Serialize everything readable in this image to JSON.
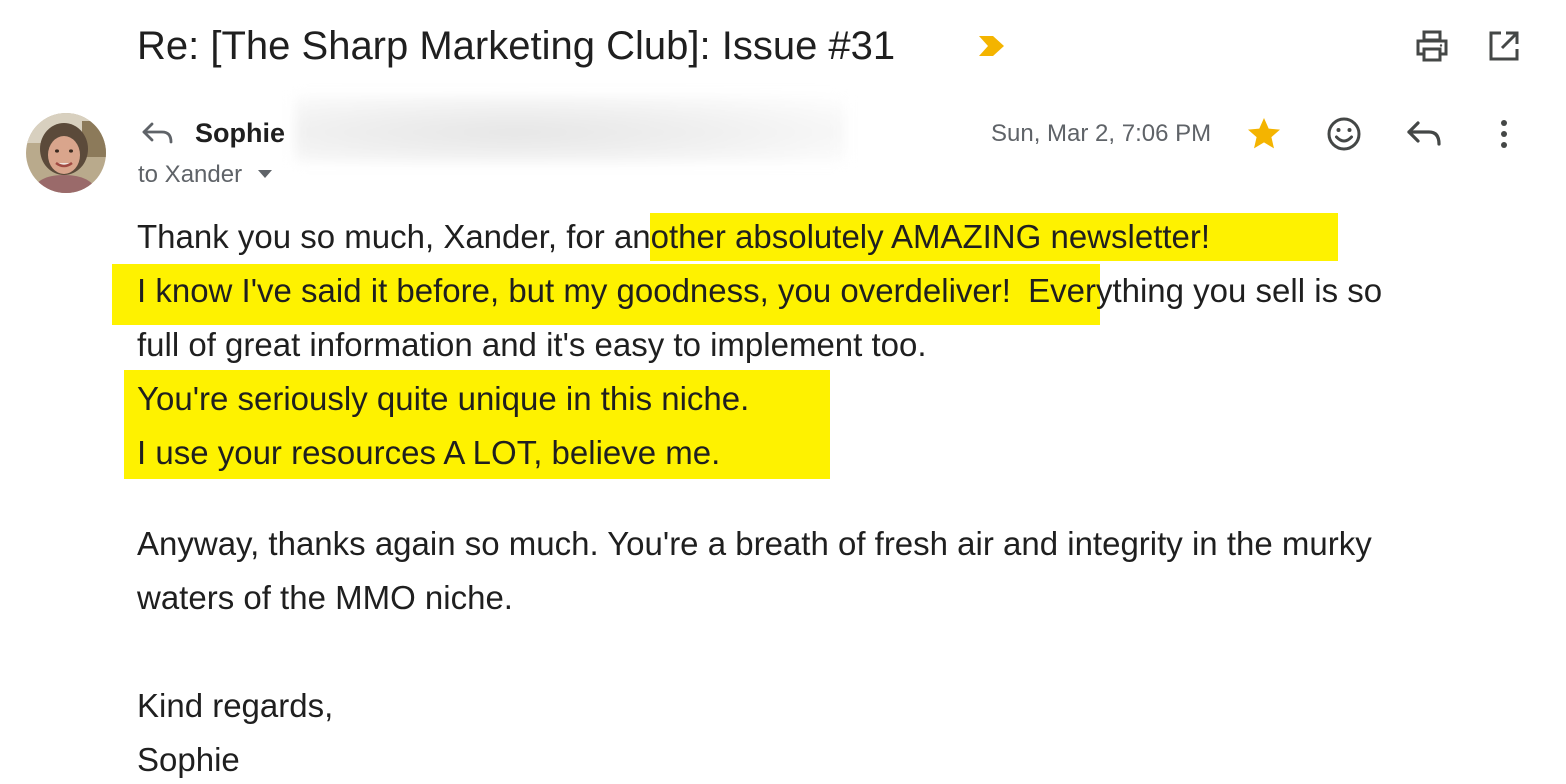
{
  "subject": "Re: [The Sharp Marketing Club]: Issue #31",
  "icons": {
    "label_marker": "importance-marker-icon",
    "print": "print-icon",
    "open_new_window": "open-in-new-window-icon",
    "star": "star-icon",
    "emoji": "emoji-reaction-icon",
    "reply": "reply-icon",
    "more": "more-vert-icon",
    "avatar": "avatar"
  },
  "colors": {
    "highlight": "#fef200",
    "star": "#f4b400",
    "marker": "#f4b400"
  },
  "message": {
    "sender_name": "Sophie",
    "recipient": "to Xander",
    "date": "Sun, Mar 2, 7:06 PM",
    "lines": {
      "l1_plain": "Thank you so much, Xander, for",
      "l1_hl": "another absolutely AMAZING newsletter!",
      "l2_hl": "I know I've said it before, but my goodness, you overdeliver!",
      "l2_plain": "Everything you sell is so",
      "l3": "full of great information and it's easy to implement too.",
      "l4": "You're seriously quite unique in this niche.",
      "l5": "I use your resources A LOT, believe me.",
      "p2_l1": "Anyway, thanks again so much.  You're a breath of fresh air and integrity in the murky",
      "p2_l2": "waters of the MMO niche.",
      "closing": "Kind regards,",
      "signature": "Sophie"
    }
  }
}
